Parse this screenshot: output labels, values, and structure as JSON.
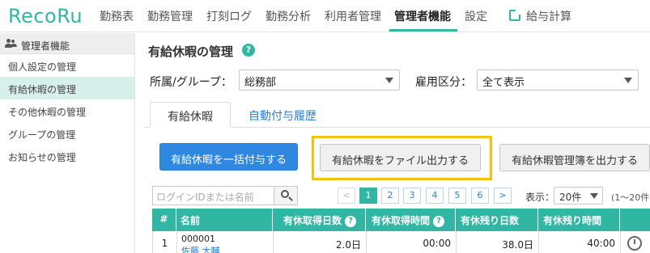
{
  "app": {
    "logo": "RecoRu"
  },
  "nav": {
    "items": [
      "勤務表",
      "勤務管理",
      "打刻ログ",
      "勤務分析",
      "利用者管理",
      "管理者機能",
      "設定"
    ],
    "active": "管理者機能",
    "external": "給与計算"
  },
  "sidebar": {
    "header": "管理者機能",
    "items": [
      "個人設定の管理",
      "有給休暇の管理",
      "その他休暇の管理",
      "グループの管理",
      "お知らせの管理"
    ],
    "active": "有給休暇の管理"
  },
  "page": {
    "title": "有給休暇の管理",
    "help": "?"
  },
  "filters": {
    "group_label": "所属/グループ：",
    "group_value": "総務部",
    "employment_label": "雇用区分：",
    "employment_value": "全て表示"
  },
  "tabs": [
    "有給休暇",
    "自動付与履歴"
  ],
  "buttons": {
    "bulk_grant": "有給休暇を一括付与する",
    "file_export": "有給休暇をファイル出力する",
    "ledger_export": "有給休暇管理簿を出力する"
  },
  "search": {
    "placeholder": "ログインIDまたは名前"
  },
  "pagination": {
    "prev": "<",
    "pages": [
      "1",
      "2",
      "3",
      "4",
      "5",
      "6"
    ],
    "current": "1",
    "next": ">",
    "display_label": "表示：",
    "per_page": "20件",
    "range": "(1〜20件"
  },
  "table": {
    "headers": [
      "#",
      "名前",
      "有休取得日数",
      "有休取得時間",
      "有休残り日数",
      "有休残り時間"
    ],
    "rows": [
      {
        "index": "1",
        "id": "000001",
        "name": "佐藤 大輔",
        "taken_days": "2.0日",
        "taken_hours": "00:00",
        "remaining_days": "38.0日",
        "remaining_hours": "40:00"
      }
    ]
  },
  "colors": {
    "accent": "#32b6a4",
    "primary_button": "#2e88e0",
    "highlight": "#f5c20a",
    "link": "#2b7fd6"
  },
  "icons": {
    "sidebar_header": "people-icon",
    "nav_external": "external-link-icon",
    "help": "help-icon",
    "search": "search-icon",
    "row_action": "history-icon"
  }
}
